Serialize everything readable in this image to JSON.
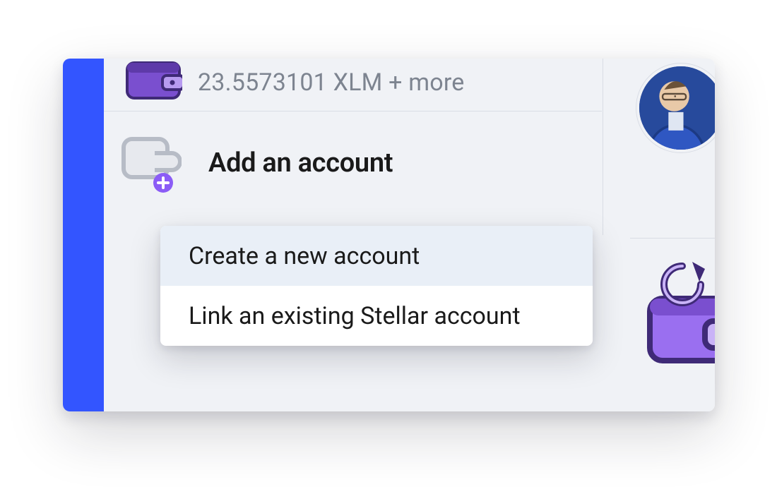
{
  "balance": {
    "text": "23.5573101 XLM + more"
  },
  "add_account": {
    "label": "Add an account",
    "menu": {
      "create": "Create a new account",
      "link": "Link an existing Stellar account"
    }
  },
  "icons": {
    "wallet": "wallet-icon",
    "wallet_plus": "wallet-plus-icon",
    "receive_wallet": "receive-wallet-icon"
  },
  "colors": {
    "sidebar": "#3355ff",
    "panel": "#f0f2f6",
    "accent_purple": "#8b5cf6",
    "accent_purple_dark": "#6d3fc9",
    "text_muted": "#7d8490",
    "divider": "#d9dde5",
    "menu_highlight": "#e9eff7"
  }
}
